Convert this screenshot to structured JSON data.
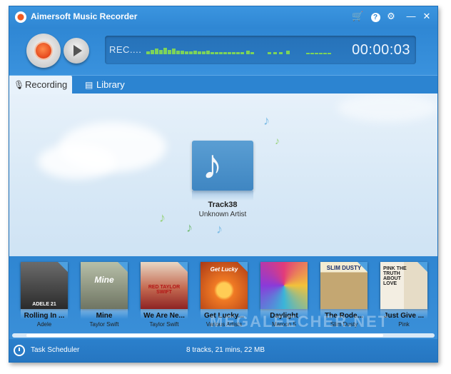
{
  "window": {
    "title": "Aimersoft Music Recorder"
  },
  "titlebar": {
    "icons": [
      "cart-icon",
      "help-icon",
      "settings-icon",
      "minimize-icon",
      "close-icon"
    ]
  },
  "recorder": {
    "status": "REC....",
    "timer": "00:00:03"
  },
  "tabs": [
    {
      "label": "Recording",
      "icon": "microphone-icon",
      "active": true
    },
    {
      "label": "Library",
      "icon": "library-icon",
      "active": false
    }
  ],
  "now_playing": {
    "title": "Track38",
    "artist": "Unknown Artist"
  },
  "albums": [
    {
      "title": "Rolling In ...",
      "artist": "Adele",
      "cover_text": "ADELE 21",
      "color": "#4a4a4a"
    },
    {
      "title": "Mine",
      "artist": "Taylor Swift",
      "cover_text": "Mine",
      "color": "#8a8f7a"
    },
    {
      "title": "We Are Ne...",
      "artist": "Taylor Swift",
      "cover_text": "RED TAYLOR SWIFT",
      "color": "#9e2a2a"
    },
    {
      "title": "Get Lucky...",
      "artist": "Various Artists",
      "cover_text": "Get Lucky",
      "color": "#d9541a"
    },
    {
      "title": "Daylight",
      "artist": "Maroon 5",
      "cover_text": "",
      "color": "#c23e7a"
    },
    {
      "title": "The Rode...",
      "artist": "Slim Dusty",
      "cover_text": "SLIM DUSTY",
      "color": "#c9b27a"
    },
    {
      "title": "Just Give ...",
      "artist": "Pink",
      "cover_text": "PINK THE TRUTH ABOUT LOVE",
      "color": "#e8e2d4"
    }
  ],
  "statusbar": {
    "scheduler": "Task Scheduler",
    "info": "8 tracks, 21 mins, 22 MB"
  },
  "watermark": "MEGALEECHER.NET"
}
